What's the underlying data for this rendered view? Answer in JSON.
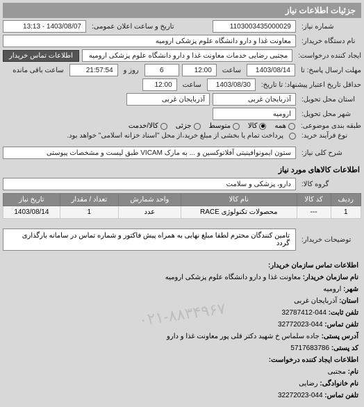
{
  "header": "جزئیات اطلاعات نیاز",
  "fields": {
    "number_label": "شماره نیاز:",
    "number": "1103003435000029",
    "announce_label": "تاریخ و ساعت اعلان عمومی:",
    "announce": "1403/08/07 - 13:13",
    "buyer_label": "نام دستگاه خریدار:",
    "buyer": "معاونت غذا و دارو دانشگاه علوم پزشکی ارومیه",
    "requester_label": "ایجاد کننده درخواست:",
    "requester": "مجتبی رضایی خدمات معاونت غذا و دارو دانشگاه علوم پزشکی ارومیه",
    "contact_btn": "اطلاعات تماس خریدار",
    "deadline_label": "مهلت ارسال پاسخ: تا",
    "deadline_date": "1403/08/14",
    "time_label": "ساعت",
    "deadline_time": "12:00",
    "days": "6",
    "day_label": "روز و",
    "remain_time": "21:57:54",
    "remain_label": "ساعت باقی مانده",
    "valid_label": "حداقل تاریخ اعتبار پیشنهاد: تا تاریخ:",
    "valid_date": "1403/08/30",
    "valid_time": "12:00",
    "province_label": "استان محل تحویل:",
    "province": "آذربایجان غربی",
    "province2": "آذربایجان غربی",
    "city_label": "شهر محل تحویل:",
    "city": "ارومیه",
    "category_label": "طبقه بندی موضوعی:",
    "cat_all": "همه",
    "cat_goods": "کالا",
    "cat_mid": "متوسط",
    "cat_small": "جزئی",
    "cat_service": "کالا/خدمت",
    "process_label": "نوع فرآیند خرید:",
    "process_text": "پرداخت تمام یا بخشی از مبلغ خرید،از محل \"اسناد خزانه اسلامی\" خواهد بود.",
    "desc_label": "شرح کلی نیاز:",
    "desc": "ستون ایمونوافینیتی آفلاتوکسین و ... به مارک VICAM طبق لیست و مشخصات پیوستی"
  },
  "goods": {
    "title": "اطلاعات کالاهای مورد نیاز",
    "group_label": "گروه کالا:",
    "group": "دارو، پزشکی و سلامت",
    "headers": {
      "row": "ردیف",
      "code": "کد کالا",
      "name": "نام کالا",
      "unit": "واحد شمارش",
      "qty": "تعداد / مقدار",
      "date": "تاریخ نیاز"
    },
    "row1": {
      "idx": "1",
      "code": "---",
      "name": "محصولات تکنولوژی RACE",
      "unit": "عدد",
      "qty": "1",
      "date": "1403/08/14"
    }
  },
  "note": "تامین کنندگان محترم لطفا مبلغ نهایی به همراه پیش فاکتور و شماره تماس در سامانه بارگذاری گردد",
  "buyer_note_label": "توضیحات خریدار:",
  "contact": {
    "title": "اطلاعات تماس سازمان خریدار:",
    "org_label": "نام سازمان خریدار:",
    "org": "معاونت غذا و دارو دانشگاه علوم پزشکی ارومیه",
    "city_label": "شهر:",
    "city": "ارومیه",
    "province_label": "استان:",
    "province": "آذربایجان غربی",
    "phone_label": "تلفن ثابت:",
    "phone": "044-32787412",
    "fax_label": "تلفن تماس:",
    "fax": "044-32772023",
    "address_label": "آدرس پستی:",
    "address": "جاده سلماس خ شهید دکتر قلی پور معاونت غذا و دارو",
    "postal_label": "کد پستی:",
    "postal": "5717683786",
    "req_title": "اطلاعات ایجاد کننده درخواست:",
    "name_label": "نام:",
    "name": "مجتبی",
    "lname_label": "نام خانوادگی:",
    "lname": "رضایی",
    "rphone_label": "تلفن تماس:",
    "rphone": "044-32272023"
  },
  "watermark": "۰۲۱-۸۸۳۴۹۶۷"
}
